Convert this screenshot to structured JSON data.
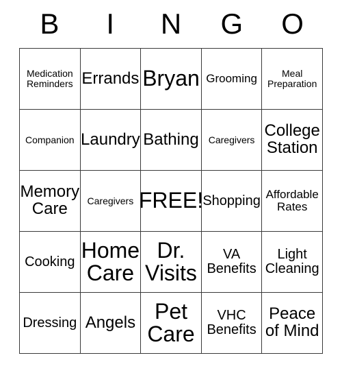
{
  "header": {
    "letters": [
      "B",
      "I",
      "N",
      "G",
      "O"
    ]
  },
  "grid": {
    "rows": 5,
    "columns": 5,
    "free_space": "FREE!",
    "cells": [
      [
        {
          "text": "Medication\nReminders",
          "size": "s-xs"
        },
        {
          "text": "Errands",
          "size": "s-lg"
        },
        {
          "text": "Bryan",
          "size": "s-xxl"
        },
        {
          "text": "Grooming",
          "size": "s-sm"
        },
        {
          "text": "Meal\nPreparation",
          "size": "s-xs"
        }
      ],
      [
        {
          "text": "Companion",
          "size": "s-xs"
        },
        {
          "text": "Laundry",
          "size": "s-lg"
        },
        {
          "text": "Bathing",
          "size": "s-lg"
        },
        {
          "text": "Caregivers",
          "size": "s-xs"
        },
        {
          "text": "College\nStation",
          "size": "s-lg"
        }
      ],
      [
        {
          "text": "Memory\nCare",
          "size": "s-lg"
        },
        {
          "text": "Caregivers",
          "size": "s-xs"
        },
        {
          "text": "FREE!",
          "size": "s-xxl"
        },
        {
          "text": "Shopping",
          "size": "s-md"
        },
        {
          "text": "Affordable\nRates",
          "size": "s-sm"
        }
      ],
      [
        {
          "text": "Cooking",
          "size": "s-md"
        },
        {
          "text": "Home\nCare",
          "size": "s-xxl"
        },
        {
          "text": "Dr.\nVisits",
          "size": "s-xxl"
        },
        {
          "text": "VA\nBenefits",
          "size": "s-md"
        },
        {
          "text": "Light\nCleaning",
          "size": "s-md"
        }
      ],
      [
        {
          "text": "Dressing",
          "size": "s-md"
        },
        {
          "text": "Angels",
          "size": "s-lg"
        },
        {
          "text": "Pet\nCare",
          "size": "s-xxl"
        },
        {
          "text": "VHC\nBenefits",
          "size": "s-md"
        },
        {
          "text": "Peace\nof Mind",
          "size": "s-lg"
        }
      ]
    ]
  },
  "colors": {
    "grid_line": "#3a3a3a",
    "text": "#000000",
    "background": "#ffffff"
  }
}
